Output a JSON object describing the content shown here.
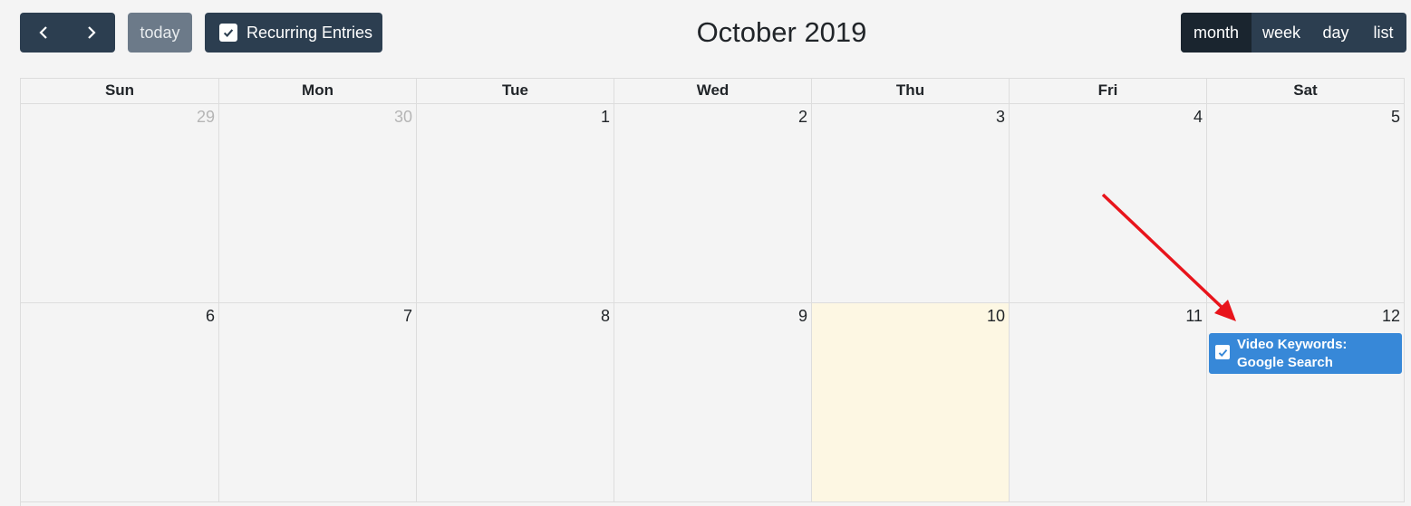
{
  "toolbar": {
    "prev_icon": "chevron-left-icon",
    "next_icon": "chevron-right-icon",
    "today_label": "today",
    "recurring_label": "Recurring Entries",
    "title": "October 2019",
    "views": [
      {
        "label": "month",
        "active": true
      },
      {
        "label": "week",
        "active": false
      },
      {
        "label": "day",
        "active": false
      },
      {
        "label": "list",
        "active": false
      }
    ]
  },
  "calendar": {
    "weekdays": [
      "Sun",
      "Mon",
      "Tue",
      "Wed",
      "Thu",
      "Fri",
      "Sat"
    ],
    "weeks": [
      {
        "days": [
          "29",
          "30",
          "1",
          "2",
          "3",
          "4",
          "5"
        ]
      },
      {
        "days": [
          "6",
          "7",
          "8",
          "9",
          "10",
          "11",
          "12"
        ]
      }
    ],
    "event": {
      "title": "Video Keywords: Google Search"
    }
  },
  "colors": {
    "button_dark": "#2c3e50",
    "button_active": "#1a252f",
    "today_button": "#6c7a89",
    "today_highlight": "#fdf7e3",
    "event": "#3788d8",
    "annotation_arrow": "#e8141b"
  }
}
